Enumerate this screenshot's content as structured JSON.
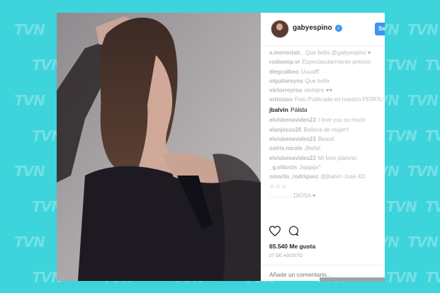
{
  "watermark": "TVN",
  "post": {
    "username": "gabyespino",
    "follow_label": "Se",
    "comments": [
      {
        "user": "a.morontab_",
        "text": "Que bella @gabyespino ♥",
        "faded": true
      },
      {
        "user": "rodsemp.vr",
        "text": "Espectacularmente precios",
        "faded": true
      },
      {
        "user": "diegcalbeo",
        "text": "Uuuufff",
        "faded": true
      },
      {
        "user": "olguitareyna",
        "text": "Que bella",
        "faded": true
      },
      {
        "user": "victorreyroa",
        "text": "siempre ♥♥",
        "faded": true
      },
      {
        "user": "artistasv",
        "text": "Foto Publicada en nuestro PERFIL!",
        "faded": true,
        "wrap": true
      },
      {
        "user": "jbalvin",
        "text": "Pálida",
        "faded": false,
        "caption": true
      },
      {
        "user": "elvisbenavides23",
        "text": "I love you so much",
        "faded": true
      },
      {
        "user": "alanjesus26",
        "text": "Belleza de mujer!!",
        "faded": true
      },
      {
        "user": "elvisbenavides23",
        "text": "Beauti",
        "faded": true
      },
      {
        "user": "osiris.nicole",
        "text": "¡Bella!",
        "faded": true
      },
      {
        "user": "elvisbenavides23",
        "text": "Mi love platonic",
        "faded": true
      },
      {
        "user": "_g.elliocin",
        "text": "Jajajaja^",
        "faded": true
      },
      {
        "user": "omarlis_rodriguez",
        "text": "@jbalvin José XD",
        "faded": true
      },
      {
        "user": "",
        "text": "☺☺☺",
        "faded": true
      },
      {
        "user": "",
        "text": "………… DIOSA ♥",
        "faded": true
      }
    ],
    "likes": "65.540 Me gusta",
    "date": "27 DE AGOSTO",
    "add_comment_placeholder": "Añade un comentario..."
  },
  "icons": {
    "like": "heart-icon",
    "comment": "comment-bubble-icon",
    "verified": "verified-badge-icon"
  },
  "colors": {
    "background": "#3dd4dc",
    "accent": "#3897f0",
    "text": "#262626"
  }
}
